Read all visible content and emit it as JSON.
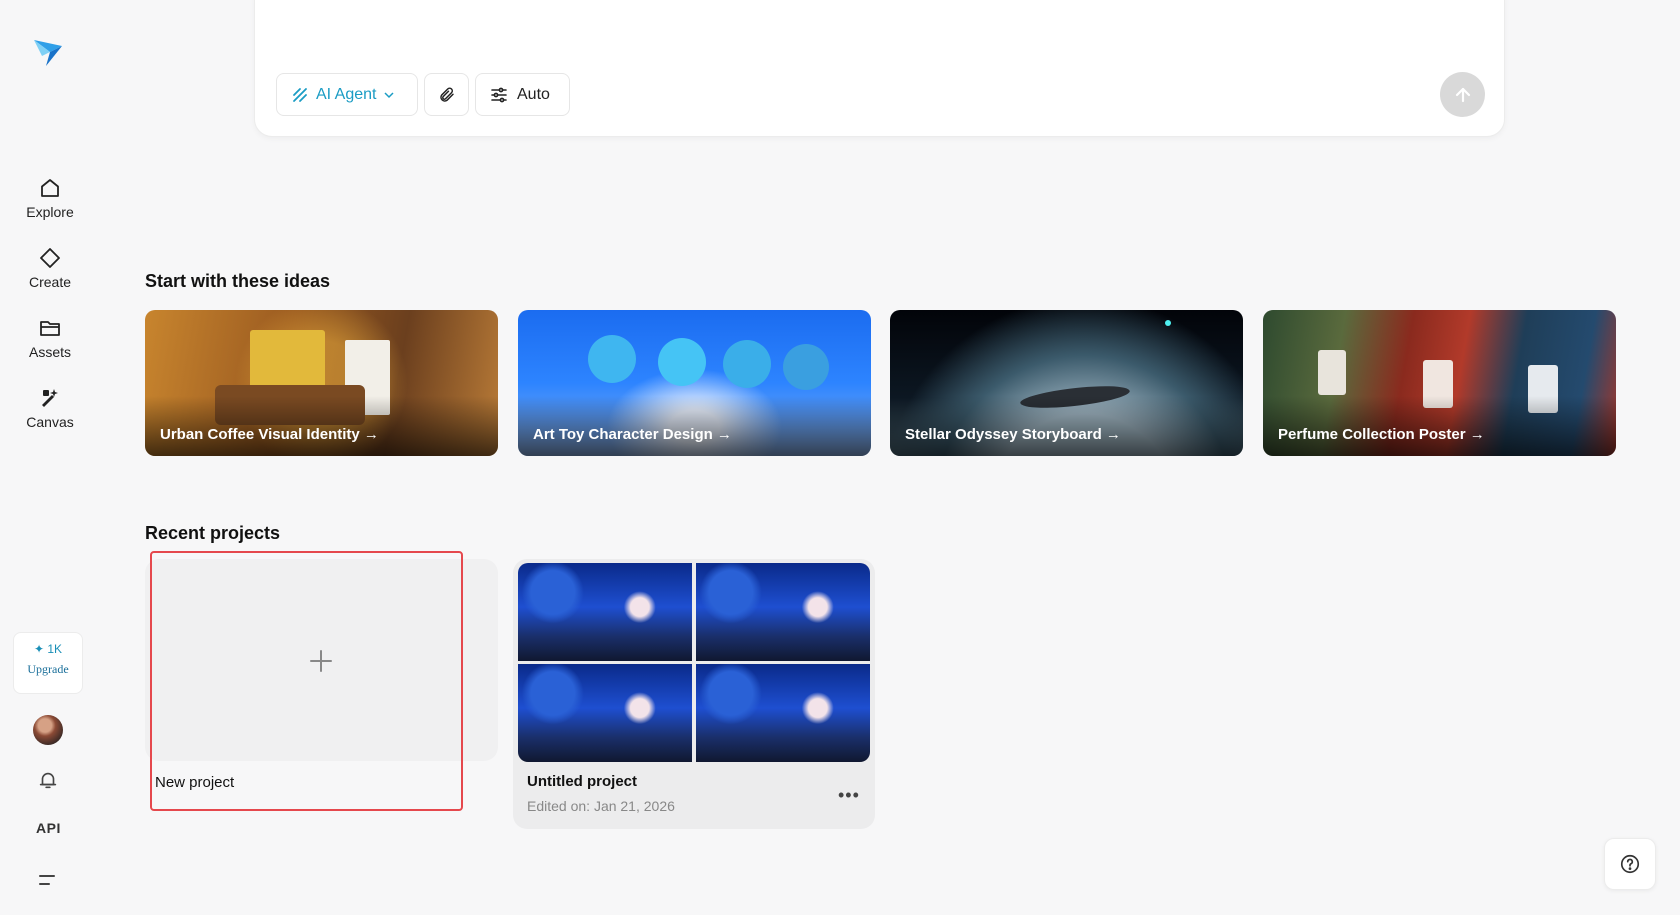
{
  "sidebar": {
    "nav": [
      {
        "label": "Explore",
        "icon": "home-icon"
      },
      {
        "label": "Create",
        "icon": "diamond-icon"
      },
      {
        "label": "Assets",
        "icon": "folder-icon"
      },
      {
        "label": "Canvas",
        "icon": "magic-wand-icon"
      }
    ],
    "credits": "1K",
    "upgrade_label": "Upgrade",
    "api_label": "API"
  },
  "prompt": {
    "agent_label": "AI Agent",
    "mode_label": "Auto"
  },
  "ideas": {
    "title": "Start with these ideas",
    "cards": [
      {
        "caption": "Urban Coffee Visual Identity →"
      },
      {
        "caption": "Art Toy Character Design →"
      },
      {
        "caption": "Stellar Odyssey Storyboard →"
      },
      {
        "caption": "Perfume Collection Poster →"
      }
    ]
  },
  "recent": {
    "title": "Recent projects",
    "new_project_label": "New project",
    "projects": [
      {
        "title": "Untitled project",
        "edited": "Edited on: Jan 21, 2026"
      }
    ]
  },
  "colors": {
    "accent": "#1a9cc4",
    "highlight": "#e5484d"
  }
}
